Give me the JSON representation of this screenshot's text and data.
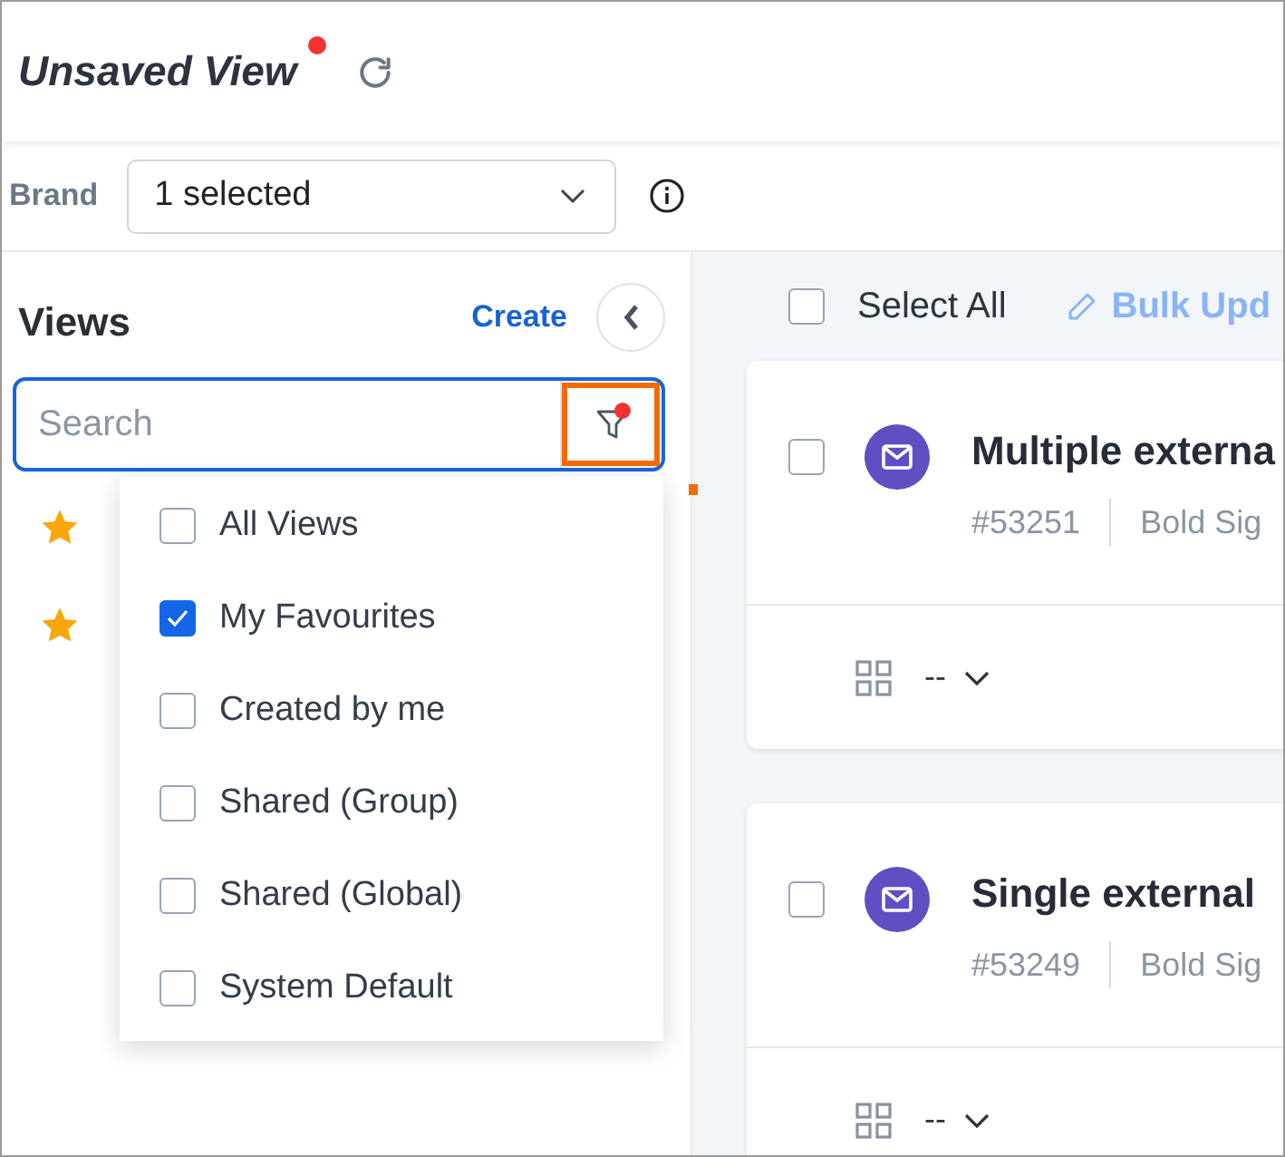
{
  "header": {
    "title": "Unsaved View",
    "unsaved": true
  },
  "filters": [
    {
      "label": "Brand",
      "value": "1 selected"
    }
  ],
  "views_panel": {
    "title": "Views",
    "create": "Create",
    "search": {
      "placeholder": "Search"
    },
    "filter_active": true,
    "filter_highlighted": true,
    "items": [
      {
        "favourite": true
      },
      {
        "favourite": true
      }
    ]
  },
  "filter_menu": {
    "open": true,
    "options": [
      {
        "label": "All Views",
        "checked": false
      },
      {
        "label": "My Favourites",
        "checked": true
      },
      {
        "label": "Created by me",
        "checked": false
      },
      {
        "label": "Shared (Group)",
        "checked": false
      },
      {
        "label": "Shared (Global)",
        "checked": false
      },
      {
        "label": "System Default",
        "checked": false
      }
    ]
  },
  "toolbar": {
    "select_all": {
      "label": "Select All",
      "checked": false
    },
    "bulk_update": "Bulk Upd"
  },
  "tickets": [
    {
      "title": "Multiple externa",
      "id": "#53251",
      "brand": "Bold Sig",
      "selected": false,
      "field": "--"
    },
    {
      "title": "Single external",
      "id": "#53249",
      "brand": "Bold Sig",
      "selected": false,
      "field": "--"
    }
  ]
}
